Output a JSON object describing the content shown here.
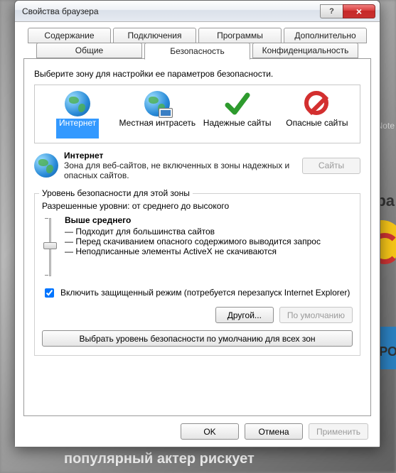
{
  "window": {
    "title": "Свойства браузера"
  },
  "titlebar": {
    "help": "?",
    "close": "×"
  },
  "tabs": {
    "row1": [
      "Содержание",
      "Подключения",
      "Программы",
      "Дополнительно"
    ],
    "row2": [
      "Общие",
      "Безопасность",
      "Конфиденциальность"
    ],
    "active": "Безопасность"
  },
  "zone_instruct": "Выберите зону для настройки ее параметров безопасности.",
  "zones": [
    {
      "label": "Интернет",
      "selected": true
    },
    {
      "label": "Местная интрасеть",
      "selected": false
    },
    {
      "label": "Надежные сайты",
      "selected": false
    },
    {
      "label": "Опасные сайты",
      "selected": false
    }
  ],
  "zone_detail": {
    "name": "Интернет",
    "desc": "Зона для веб-сайтов, не включенных в зоны надежных и опасных сайтов.",
    "sites_btn": "Сайты"
  },
  "security_group": {
    "legend": "Уровень безопасности для этой зоны",
    "allowed": "Разрешенные уровни: от среднего до высокого",
    "level_name": "Выше среднего",
    "bullets": [
      "Подходит для большинства сайтов",
      "Перед скачиванием опасного содержимого выводится запрос",
      "Неподписанные элементы ActiveX не скачиваются"
    ],
    "protected_mode": "Включить защищенный режим (потребуется перезапуск Internet Explorer)",
    "protected_checked": true,
    "custom_btn": "Другой...",
    "default_btn": "По умолчанию",
    "reset_all_btn": "Выбрать уровень безопасности по умолчанию для всех зон"
  },
  "footer": {
    "ok": "OK",
    "cancel": "Отмена",
    "apply": "Применить"
  },
  "bg": {
    "t1": "Note",
    "t2": "бра",
    "t3": "ДОРО",
    "t4": "популярный актер рискует"
  }
}
